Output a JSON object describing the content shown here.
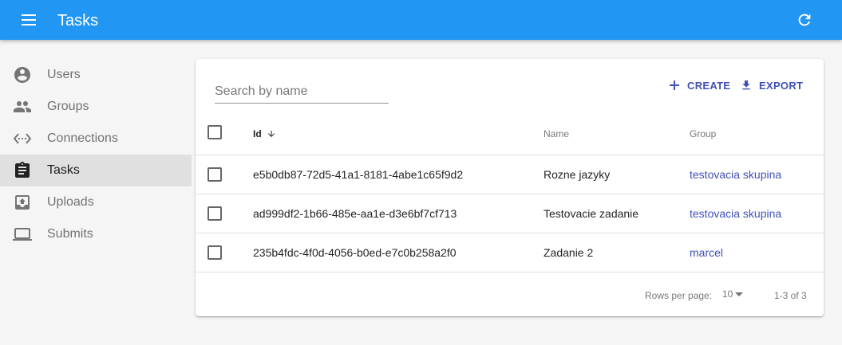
{
  "appbar": {
    "title": "Tasks",
    "color": "#2196f3",
    "menu_icon": "menu-icon",
    "refresh_icon": "refresh-icon"
  },
  "sidebar": {
    "items": [
      {
        "label": "Users",
        "icon": "account-circle-icon",
        "active": false
      },
      {
        "label": "Groups",
        "icon": "group-icon",
        "active": false
      },
      {
        "label": "Connections",
        "icon": "code-brackets-icon",
        "active": false
      },
      {
        "label": "Tasks",
        "icon": "assignment-icon",
        "active": true
      },
      {
        "label": "Uploads",
        "icon": "upload-box-icon",
        "active": false
      },
      {
        "label": "Submits",
        "icon": "laptop-icon",
        "active": false
      }
    ]
  },
  "toolbar": {
    "search_placeholder": "Search by name",
    "search_value": "",
    "create_label": "CREATE",
    "export_label": "EXPORT",
    "accent": "#3f51b5"
  },
  "table": {
    "headers": {
      "id": "Id",
      "name": "Name",
      "group": "Group"
    },
    "sort": {
      "column": "id",
      "direction": "descending"
    },
    "rows": [
      {
        "id": "e5b0db87-72d5-41a1-8181-4abe1c65f9d2",
        "name": "Rozne jazyky",
        "group": "testovacia skupina"
      },
      {
        "id": "ad999df2-1b66-485e-aa1e-d3e6bf7cf713",
        "name": "Testovacie zadanie",
        "group": "testovacia skupina"
      },
      {
        "id": "235b4fdc-4f0d-4056-b0ed-e7c0b258a2f0",
        "name": "Zadanie 2",
        "group": "marcel"
      }
    ]
  },
  "pagination": {
    "rows_per_page_label": "Rows per page:",
    "rows_per_page": "10",
    "range": "1-3 of 3"
  }
}
